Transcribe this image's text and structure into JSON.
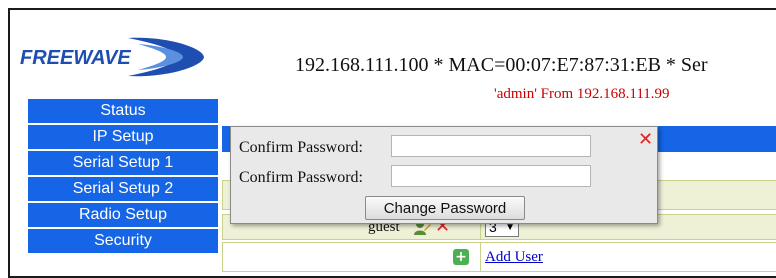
{
  "brand": {
    "logo_text": "FREEWAVE"
  },
  "header": {
    "device_line": "192.168.111.100 * MAC=00:07:E7:87:31:EB * Ser",
    "user_line": "'admin' From 192.168.111.99"
  },
  "sidebar": {
    "items": [
      {
        "label": "Status"
      },
      {
        "label": "IP Setup"
      },
      {
        "label": "Serial Setup 1"
      },
      {
        "label": "Serial Setup 2"
      },
      {
        "label": "Radio Setup"
      },
      {
        "label": "Security"
      }
    ]
  },
  "users_panel": {
    "header_text": "",
    "rows": [
      {
        "username": "guest",
        "level": "3"
      }
    ],
    "add_user_label": "Add User"
  },
  "modal": {
    "field1_label": "Confirm Password:",
    "field2_label": "Confirm Password:",
    "field1_value": "",
    "field2_value": "",
    "submit_label": "Change Password"
  },
  "colors": {
    "nav_blue": "#1565e6",
    "row_bg": "#eef1d6",
    "alert_red": "#cc0000",
    "link_blue": "#0000cc"
  }
}
